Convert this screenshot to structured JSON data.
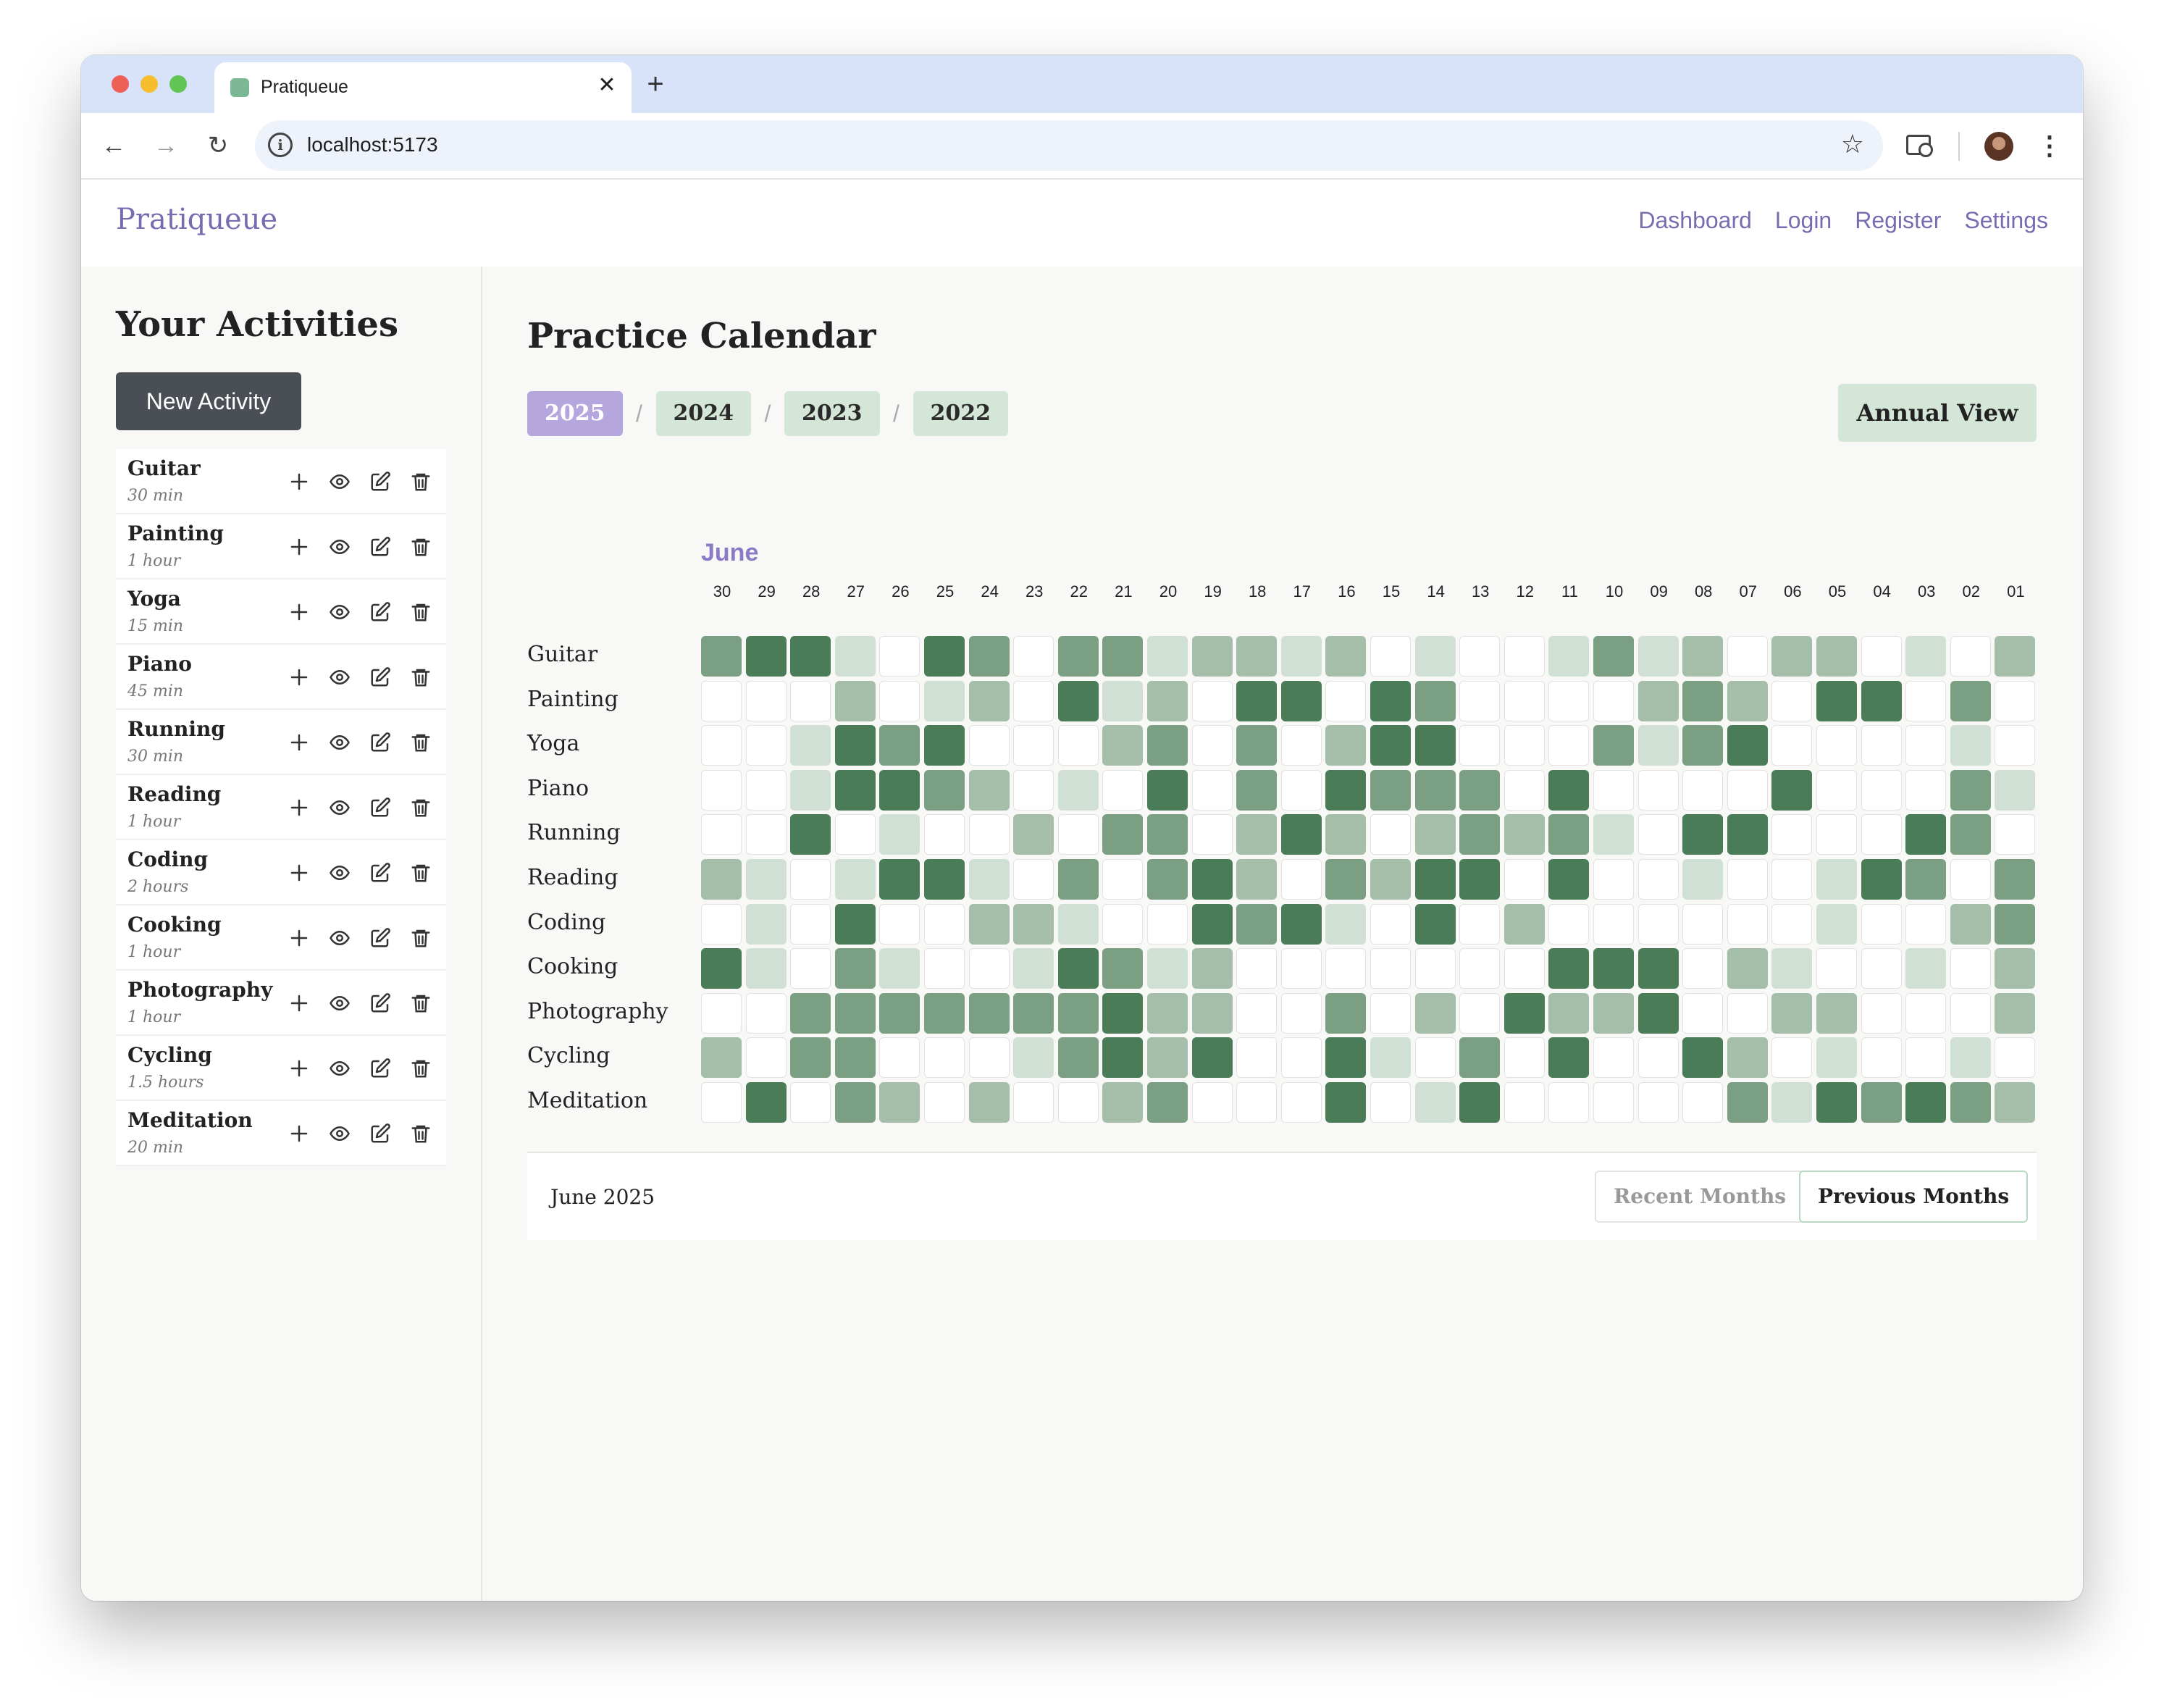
{
  "browser": {
    "tab_title": "Pratiqueue",
    "url": "localhost:5173"
  },
  "app": {
    "brand": "Pratiqueue",
    "nav": [
      "Dashboard",
      "Login",
      "Register",
      "Settings"
    ]
  },
  "sidebar": {
    "title": "Your Activities",
    "new_activity_label": "New Activity",
    "activities": [
      {
        "name": "Guitar",
        "duration": "30 min"
      },
      {
        "name": "Painting",
        "duration": "1 hour"
      },
      {
        "name": "Yoga",
        "duration": "15 min"
      },
      {
        "name": "Piano",
        "duration": "45 min"
      },
      {
        "name": "Running",
        "duration": "30 min"
      },
      {
        "name": "Reading",
        "duration": "1 hour"
      },
      {
        "name": "Coding",
        "duration": "2 hours"
      },
      {
        "name": "Cooking",
        "duration": "1 hour"
      },
      {
        "name": "Photography",
        "duration": "1 hour"
      },
      {
        "name": "Cycling",
        "duration": "1.5 hours"
      },
      {
        "name": "Meditation",
        "duration": "20 min"
      }
    ]
  },
  "calendar": {
    "title": "Practice Calendar",
    "years": [
      "2025",
      "2024",
      "2023",
      "2022"
    ],
    "active_year": "2025",
    "annual_view_label": "Annual View",
    "month": "June",
    "days": [
      "30",
      "29",
      "28",
      "27",
      "26",
      "25",
      "24",
      "23",
      "22",
      "21",
      "20",
      "19",
      "18",
      "17",
      "16",
      "15",
      "14",
      "13",
      "12",
      "11",
      "10",
      "09",
      "08",
      "07",
      "06",
      "05",
      "04",
      "03",
      "02",
      "01"
    ],
    "level_colors": [
      "#ffffff",
      "#d1e0d4",
      "#a4bea9",
      "#7a9f83",
      "#4b7c58"
    ],
    "rows": [
      {
        "activity": "Guitar",
        "levels": [
          3,
          4,
          4,
          1,
          0,
          4,
          3,
          0,
          3,
          3,
          1,
          2,
          2,
          1,
          2,
          0,
          1,
          0,
          0,
          1,
          3,
          1,
          2,
          0,
          2,
          2,
          0,
          1,
          0,
          2
        ]
      },
      {
        "activity": "Painting",
        "levels": [
          0,
          0,
          0,
          2,
          0,
          1,
          2,
          0,
          4,
          1,
          2,
          0,
          4,
          4,
          0,
          4,
          3,
          0,
          0,
          0,
          0,
          2,
          3,
          2,
          0,
          4,
          4,
          0,
          3,
          0
        ]
      },
      {
        "activity": "Yoga",
        "levels": [
          0,
          0,
          1,
          4,
          3,
          4,
          0,
          0,
          0,
          2,
          3,
          0,
          3,
          0,
          2,
          4,
          4,
          0,
          0,
          0,
          3,
          1,
          3,
          4,
          0,
          0,
          0,
          0,
          1,
          0
        ]
      },
      {
        "activity": "Piano",
        "levels": [
          0,
          0,
          1,
          4,
          4,
          3,
          2,
          0,
          1,
          0,
          4,
          0,
          3,
          0,
          4,
          3,
          3,
          3,
          0,
          4,
          0,
          0,
          0,
          0,
          4,
          0,
          0,
          0,
          3,
          1
        ]
      },
      {
        "activity": "Running",
        "levels": [
          0,
          0,
          4,
          0,
          1,
          0,
          0,
          2,
          0,
          3,
          3,
          0,
          2,
          4,
          2,
          0,
          2,
          3,
          2,
          3,
          1,
          0,
          4,
          4,
          0,
          0,
          0,
          4,
          3,
          0
        ]
      },
      {
        "activity": "Reading",
        "levels": [
          2,
          1,
          0,
          1,
          4,
          4,
          1,
          0,
          3,
          0,
          3,
          4,
          2,
          0,
          3,
          2,
          4,
          4,
          0,
          4,
          0,
          0,
          1,
          0,
          0,
          1,
          4,
          3,
          0,
          3
        ]
      },
      {
        "activity": "Coding",
        "levels": [
          0,
          1,
          0,
          4,
          0,
          0,
          2,
          2,
          1,
          0,
          0,
          4,
          3,
          4,
          1,
          0,
          4,
          0,
          2,
          0,
          0,
          0,
          0,
          0,
          0,
          1,
          0,
          0,
          2,
          3
        ]
      },
      {
        "activity": "Cooking",
        "levels": [
          4,
          1,
          0,
          3,
          1,
          0,
          0,
          1,
          4,
          3,
          1,
          2,
          0,
          0,
          0,
          0,
          0,
          0,
          0,
          4,
          4,
          4,
          0,
          2,
          1,
          0,
          0,
          1,
          0,
          2
        ]
      },
      {
        "activity": "Photography",
        "levels": [
          0,
          0,
          3,
          3,
          3,
          3,
          3,
          3,
          3,
          4,
          2,
          2,
          0,
          0,
          3,
          0,
          2,
          0,
          4,
          2,
          2,
          4,
          0,
          0,
          2,
          2,
          0,
          0,
          0,
          2
        ]
      },
      {
        "activity": "Cycling",
        "levels": [
          2,
          0,
          3,
          3,
          0,
          0,
          0,
          1,
          3,
          4,
          2,
          4,
          0,
          0,
          4,
          1,
          0,
          3,
          0,
          4,
          0,
          0,
          4,
          2,
          0,
          1,
          0,
          0,
          1,
          0
        ]
      },
      {
        "activity": "Meditation",
        "levels": [
          0,
          4,
          0,
          3,
          2,
          0,
          2,
          0,
          0,
          2,
          3,
          0,
          0,
          0,
          4,
          0,
          1,
          4,
          0,
          0,
          0,
          0,
          0,
          3,
          1,
          4,
          3,
          4,
          3,
          2
        ]
      }
    ],
    "footer_month": "June 2025",
    "recent_months_label": "Recent Months",
    "previous_months_label": "Previous Months"
  },
  "icons": {
    "add": "plus-icon",
    "view": "eye-icon",
    "edit": "edit-icon",
    "delete": "trash-icon"
  }
}
